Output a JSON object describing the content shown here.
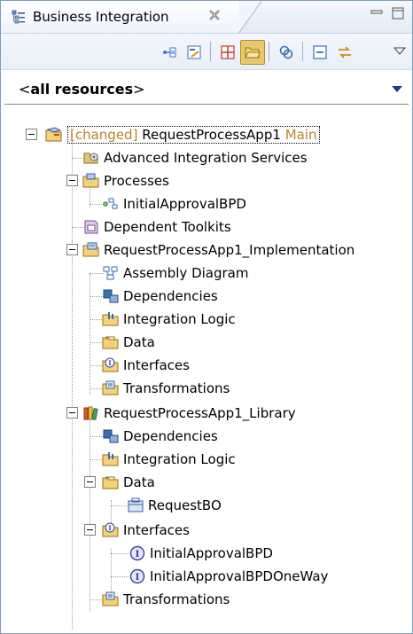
{
  "tab": {
    "title": "Business Integration"
  },
  "filter": {
    "label_prefix": "<",
    "label_main": "all resources",
    "label_suffix": ">"
  },
  "tree": {
    "root": {
      "changed_tag": "[changed]",
      "name": "RequestProcessApp1",
      "main_tag": "Main"
    },
    "items": [
      {
        "label": "Advanced Integration Services",
        "icon": "integration-services-icon"
      },
      {
        "label": "Processes",
        "icon": "processes-folder-icon"
      },
      {
        "label": "InitialApprovalBPD",
        "icon": "bpd-icon"
      },
      {
        "label": "Dependent Toolkits",
        "icon": "toolkits-icon"
      },
      {
        "label": "RequestProcessApp1_Implementation",
        "icon": "module-icon"
      },
      {
        "label": "Assembly Diagram",
        "icon": "assembly-diagram-icon"
      },
      {
        "label": "Dependencies",
        "icon": "dependencies-icon"
      },
      {
        "label": "Integration Logic",
        "icon": "integration-logic-icon"
      },
      {
        "label": "Data",
        "icon": "data-folder-icon"
      },
      {
        "label": "Interfaces",
        "icon": "interfaces-icon"
      },
      {
        "label": "Transformations",
        "icon": "transformations-icon"
      },
      {
        "label": "RequestProcessApp1_Library",
        "icon": "library-icon"
      },
      {
        "label": "Dependencies",
        "icon": "dependencies-icon"
      },
      {
        "label": "Integration Logic",
        "icon": "integration-logic-icon"
      },
      {
        "label": "Data",
        "icon": "data-folder-icon"
      },
      {
        "label": "RequestBO",
        "icon": "business-object-icon"
      },
      {
        "label": "Interfaces",
        "icon": "interfaces-icon"
      },
      {
        "label": "InitialApprovalBPD",
        "icon": "interface-icon"
      },
      {
        "label": "InitialApprovalBPDOneWay",
        "icon": "interface-icon"
      },
      {
        "label": "Transformations",
        "icon": "transformations-icon"
      }
    ]
  },
  "colors": {
    "changed_tag": "#b7852a",
    "active_toolbar_button": "#e6c96e"
  }
}
